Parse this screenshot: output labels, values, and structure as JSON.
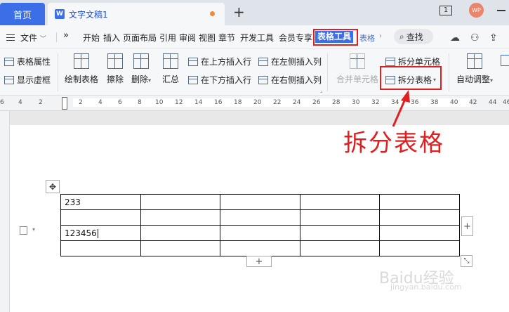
{
  "titlebar": {
    "home_tab": "首页",
    "doc_icon": "W",
    "doc_title": "文字文稿1",
    "new_tab": "+",
    "window_badge": "1",
    "avatar_text": "WP"
  },
  "menubar": {
    "file_label": "文件",
    "more_label": "»",
    "tabs": [
      "开始",
      "插入",
      "页面布局",
      "引用",
      "审阅",
      "视图",
      "章节",
      "开发工具",
      "会员专享",
      "表格工具",
      "表格"
    ],
    "search_label": "查找"
  },
  "ribbon": {
    "table_properties": "表格属性",
    "show_gridlines": "显示虚框",
    "draw_table": "绘制表格",
    "eraser": "擦除",
    "delete": "删除",
    "summary": "汇总",
    "insert_above": "在上方插入行",
    "insert_below": "在下方插入行",
    "insert_left": "在左侧插入列",
    "insert_right": "在右侧插入列",
    "merge_cells": "合并单元格",
    "split_cells": "拆分单元格",
    "split_table": "拆分表格",
    "auto_fit": "自动调整"
  },
  "ruler": {
    "ticks": [
      "6",
      "4",
      "2",
      "",
      "2",
      "4",
      "6",
      "8",
      "10",
      "12",
      "14",
      "16",
      "18",
      "20",
      "22",
      "24",
      "26",
      "28",
      "30",
      "32",
      "34",
      "36",
      "38",
      "40",
      "42",
      "44",
      "46"
    ]
  },
  "table": {
    "rows": [
      [
        "233",
        "",
        "",
        "",
        ""
      ],
      [
        "",
        "",
        "",
        "",
        ""
      ],
      [
        "123456",
        "",
        "",
        "",
        ""
      ],
      [
        "",
        "",
        "",
        "",
        ""
      ]
    ]
  },
  "annotation": "拆分表格",
  "watermark": "Baidu经验",
  "watermark_sub": "jingyan.baidu.com",
  "colors": {
    "accent": "#3c6ee8",
    "highlight_red": "#e02020"
  }
}
